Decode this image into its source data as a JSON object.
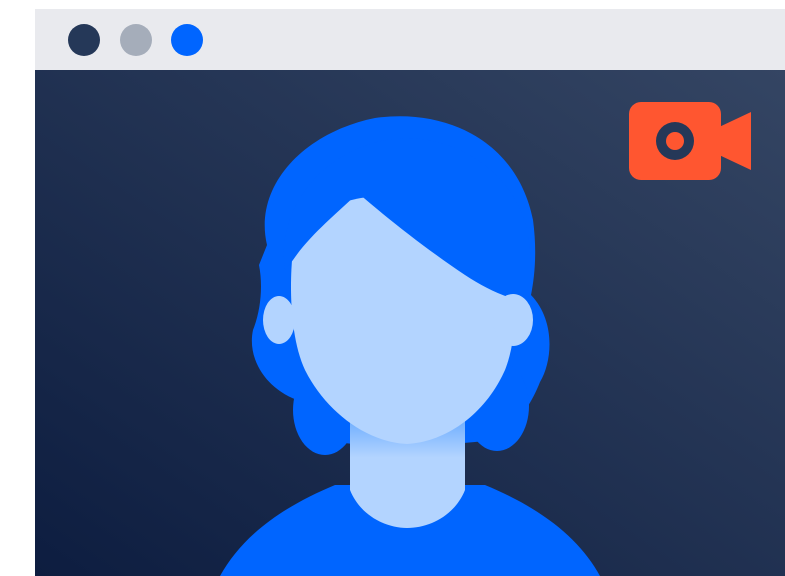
{
  "window": {
    "controls": [
      {
        "name": "window-control-1",
        "color": "#253858"
      },
      {
        "name": "window-control-2",
        "color": "#a5adba"
      },
      {
        "name": "window-control-3",
        "color": "#0065ff"
      }
    ]
  },
  "video": {
    "background_gradient": [
      "#0d1d40",
      "#344563"
    ],
    "participant_avatar": "person-silhouette-icon",
    "hair_color": "#0065ff",
    "skin_color": "#b3d4ff",
    "shirt_color": "#0065ff"
  },
  "camera_indicator": {
    "icon": "video-camera-icon",
    "color": "#ff5630",
    "lens_color": "#253858"
  }
}
